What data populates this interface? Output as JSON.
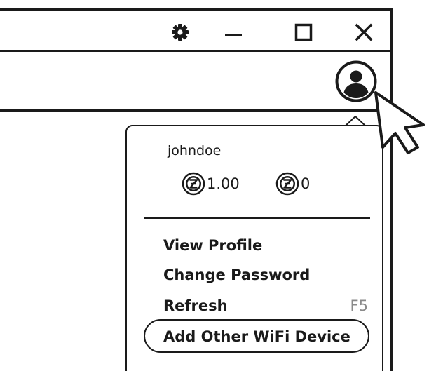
{
  "titlebar": {
    "icons": [
      "gear-icon",
      "minimize-icon",
      "maximize-icon",
      "close-icon"
    ]
  },
  "toolbar": {
    "avatar_icon": "user-avatar-icon"
  },
  "account_menu": {
    "username": "johndoe",
    "balances": [
      {
        "icon": "z-coin-icon",
        "value": "1.00"
      },
      {
        "icon": "z-coin-icon",
        "value": "0"
      }
    ],
    "items": [
      {
        "label": "View Profile"
      },
      {
        "label": "Change Password"
      },
      {
        "label": "Refresh",
        "shortcut": "F5"
      },
      {
        "label": "Add Other WiFi Device",
        "highlighted": true
      }
    ]
  },
  "colors": {
    "ink": "#1a1a1a",
    "shortcut": "#8a8a8a",
    "background": "#ffffff"
  }
}
